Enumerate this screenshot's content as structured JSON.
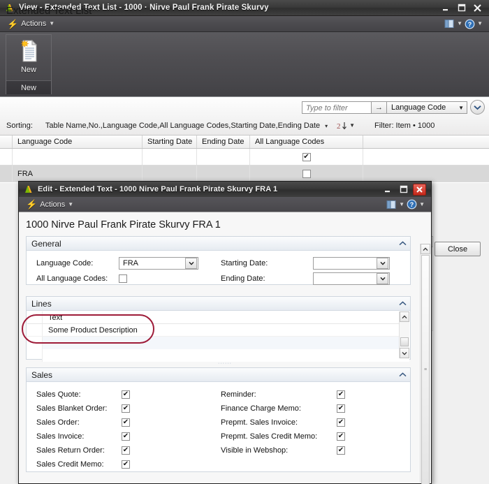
{
  "background_window": {
    "title": "View - Extended Text List - 1000 · Nirve Paul Frank Pirate Skurvy",
    "app_icon": "nav-icon",
    "window_buttons": {
      "minimize": "minimize-icon",
      "maximize": "maximize-icon",
      "close": "close-icon"
    },
    "actions_bar": {
      "actions_label": "Actions",
      "bolt_icon": "lightning-bolt-icon",
      "pane_icon": "notes-pane-icon",
      "help_icon": "help-icon"
    },
    "ribbon": {
      "new_button_label": "New",
      "new_button_icon": "new-document-icon",
      "group_label": "New"
    },
    "list_pane": {
      "title": "Extended Text List",
      "title_caret": "▾",
      "filter_placeholder": "Type to filter",
      "filter_value": "",
      "filter_arrow_icon": "arrow-right-icon",
      "filter_field": "Language Code",
      "expand_icon": "chevron-down-icon"
    },
    "sorting": {
      "label": "Sorting:",
      "value": "Table Name,No.,Language Code,All Language Codes,Starting Date,Ending Date",
      "caret": "▾",
      "sort_icon": "sort-az-icon",
      "filter_info": "Filter: Item • 1000"
    },
    "grid": {
      "columns": [
        "Language Code",
        "Starting Date",
        "Ending Date",
        "All Language Codes"
      ],
      "rows": [
        {
          "language_code": "",
          "starting_date": "",
          "ending_date": "",
          "all_language_codes": true,
          "selected": false
        },
        {
          "language_code": "FRA",
          "starting_date": "",
          "ending_date": "",
          "all_language_codes": false,
          "selected": true
        }
      ]
    },
    "close_button_label": "Close"
  },
  "dialog": {
    "title": "Edit - Extended Text - 1000 Nirve Paul Frank Pirate Skurvy FRA 1",
    "app_icon": "nav-icon",
    "window_buttons": {
      "minimize": "minimize-icon",
      "maximize": "maximize-icon",
      "close": "close-icon"
    },
    "actions_bar": {
      "actions_label": "Actions",
      "bolt_icon": "lightning-bolt-icon",
      "pane_icon": "notes-pane-icon",
      "help_icon": "help-icon"
    },
    "heading": "1000 Nirve Paul Frank Pirate Skurvy FRA 1",
    "general": {
      "section_title": "General",
      "collapse_icon": "chevron-up-icon",
      "fields": {
        "language_code_label": "Language Code:",
        "language_code_value": "FRA",
        "all_language_codes_label": "All Language Codes:",
        "all_language_codes_checked": false,
        "starting_date_label": "Starting Date:",
        "starting_date_value": "",
        "ending_date_label": "Ending Date:",
        "ending_date_value": ""
      }
    },
    "lines": {
      "section_title": "Lines",
      "collapse_icon": "chevron-up-icon",
      "column_header": "Text",
      "rows": [
        "Some Product Description"
      ],
      "scroll_up_icon": "chevron-up-icon",
      "scroll_down_icon": "chevron-down-icon",
      "resize_grip": "······"
    },
    "sales": {
      "section_title": "Sales",
      "collapse_icon": "chevron-up-icon",
      "left_column": [
        {
          "label": "Sales Quote:",
          "checked": true
        },
        {
          "label": "Sales Blanket Order:",
          "checked": true
        },
        {
          "label": "Sales Order:",
          "checked": true
        },
        {
          "label": "Sales Invoice:",
          "checked": true
        },
        {
          "label": "Sales Return Order:",
          "checked": true
        },
        {
          "label": "Sales Credit Memo:",
          "checked": true
        }
      ],
      "right_column": [
        {
          "label": "Reminder:",
          "checked": true
        },
        {
          "label": "Finance Charge Memo:",
          "checked": true
        },
        {
          "label": "Prepmt. Sales Invoice:",
          "checked": true
        },
        {
          "label": "Prepmt. Sales Credit Memo:",
          "checked": true
        },
        {
          "label": "Visible in Webshop:",
          "checked": true
        }
      ]
    }
  },
  "annotation": {
    "shape": "rounded-rectangle",
    "color": "#9e1b38",
    "target": "lines-text-column"
  },
  "glyphs": {
    "check": "✔",
    "chevron_up": "⌃",
    "chevron_down": "⌄",
    "caret_down": "▼",
    "arrow_right": "→",
    "bolt": "⚡",
    "minimize": "▬",
    "maximize": "❐",
    "close": "✕"
  }
}
